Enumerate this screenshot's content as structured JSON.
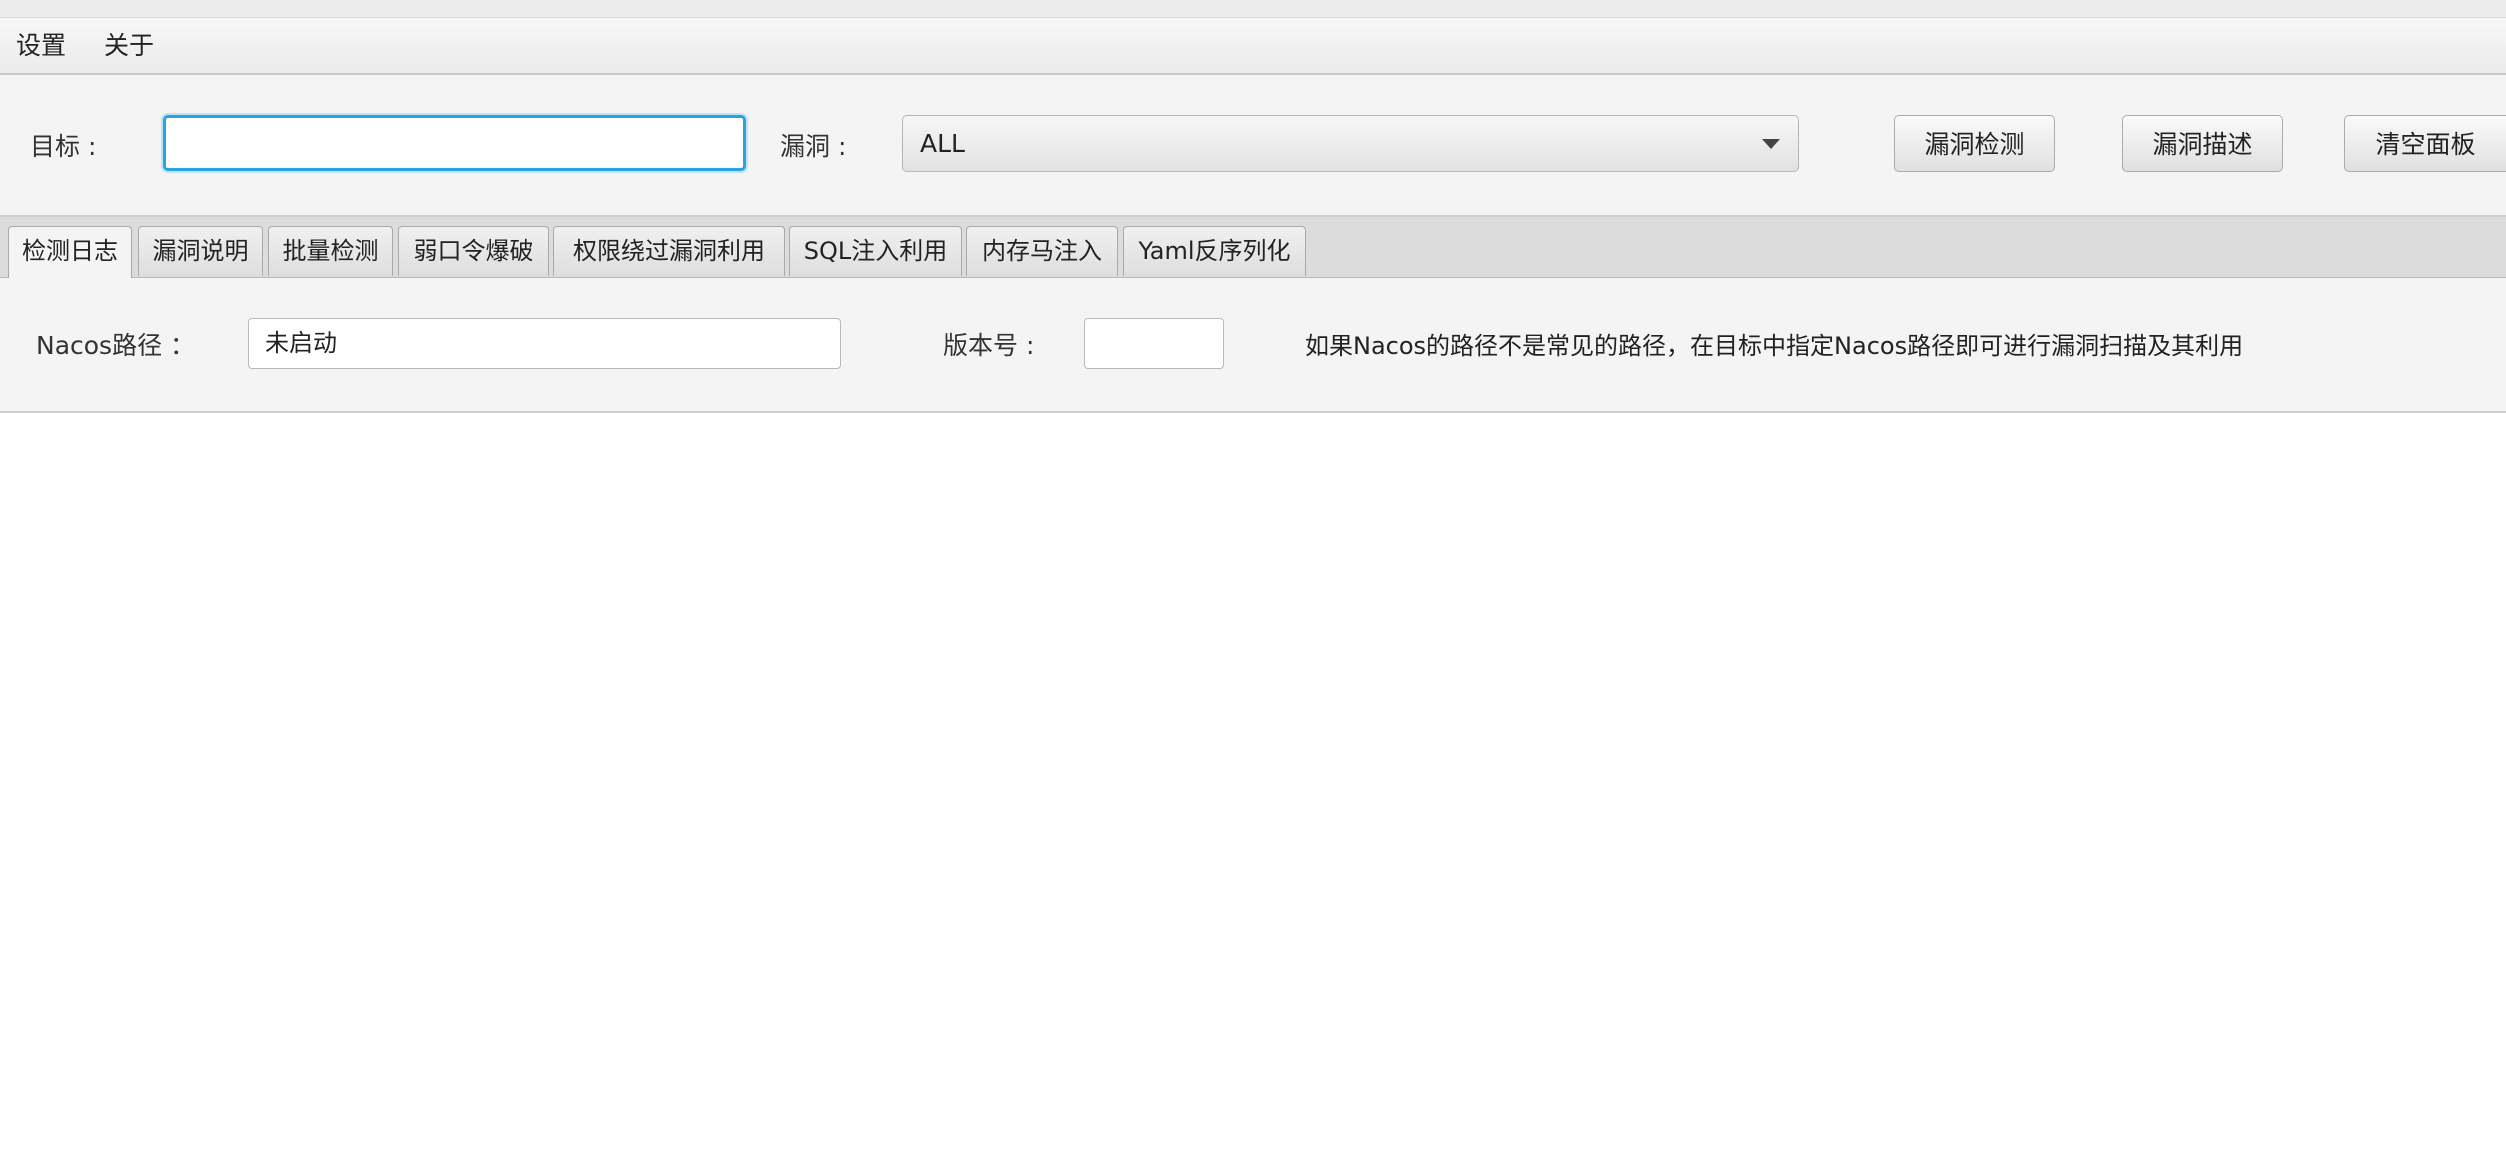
{
  "menu": {
    "settings": "设置",
    "about": "关于"
  },
  "toolbar": {
    "target_label": "目标 :",
    "target_value": "",
    "vuln_label": "漏洞 :",
    "vuln_selected": "ALL",
    "detect_button": "漏洞检测",
    "describe_button": "漏洞描述",
    "clear_button": "清空面板"
  },
  "tabs": [
    {
      "label": "检测日志",
      "active": true
    },
    {
      "label": "漏洞说明",
      "active": false
    },
    {
      "label": "批量检测",
      "active": false
    },
    {
      "label": "弱口令爆破",
      "active": false
    },
    {
      "label": "权限绕过漏洞利用",
      "active": false
    },
    {
      "label": "SQL注入利用",
      "active": false
    },
    {
      "label": "内存马注入",
      "active": false
    },
    {
      "label": "Yaml反序列化",
      "active": false
    }
  ],
  "panel": {
    "path_label": "Nacos路径 ：",
    "path_value": "未启动",
    "version_label": "版本号 :",
    "version_value": "",
    "hint": "如果Nacos的路径不是常见的路径，在目标中指定Nacos路径即可进行漏洞扫描及其利用"
  },
  "log": {
    "content": ""
  },
  "colors": {
    "focus_border": "#2aa3e0",
    "toolbar_bg": "#f4f4f4",
    "tabbar_bg": "#dcdcdc"
  }
}
